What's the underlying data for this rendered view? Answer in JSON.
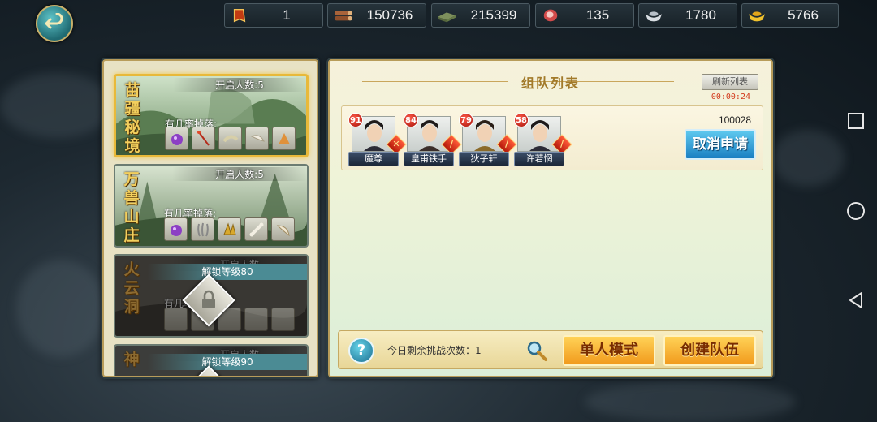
{
  "resources": [
    {
      "icon": "token-icon",
      "value": "1"
    },
    {
      "icon": "wood-icon",
      "value": "150736"
    },
    {
      "icon": "stone-icon",
      "value": "215399"
    },
    {
      "icon": "meat-icon",
      "value": "135"
    },
    {
      "icon": "silver-icon",
      "value": "1780"
    },
    {
      "icon": "gold-ingot-icon",
      "value": "5766"
    }
  ],
  "dungeons": [
    {
      "name": "苗疆秘境",
      "people": "开启人数:5",
      "drop_label": "有几率掉落:",
      "locked": false,
      "active": true
    },
    {
      "name": "万兽山庄",
      "people": "开启人数:5",
      "drop_label": "有几率掉落:",
      "locked": false,
      "active": false
    },
    {
      "name": "火云洞",
      "people": "开启人数",
      "drop_label": "有几率",
      "lock_text": "解锁等级80",
      "locked": true
    },
    {
      "name": "神",
      "people": "开启人数",
      "lock_text": "解锁等级90",
      "locked": true
    }
  ],
  "team_panel": {
    "title": "组队列表",
    "refresh_label": "刷新列表",
    "timer": "00:00:24",
    "team_id": "100028",
    "cancel_label": "取消申请",
    "members": [
      {
        "level": "91",
        "name": "魔尊"
      },
      {
        "level": "84",
        "name": "皇甫铁手"
      },
      {
        "level": "79",
        "name": "狄子轩"
      },
      {
        "level": "58",
        "name": "许若惘"
      }
    ]
  },
  "bottom": {
    "help_label": "?",
    "chance_text": "今日剩余挑战次数：1",
    "solo_label": "单人模式",
    "create_label": "创建队伍"
  },
  "colors": {
    "accent_gold": "#b89c5a",
    "cancel_blue": "#1a7fc2",
    "button_orange": "#f19a1c",
    "level_red": "#a51208"
  }
}
